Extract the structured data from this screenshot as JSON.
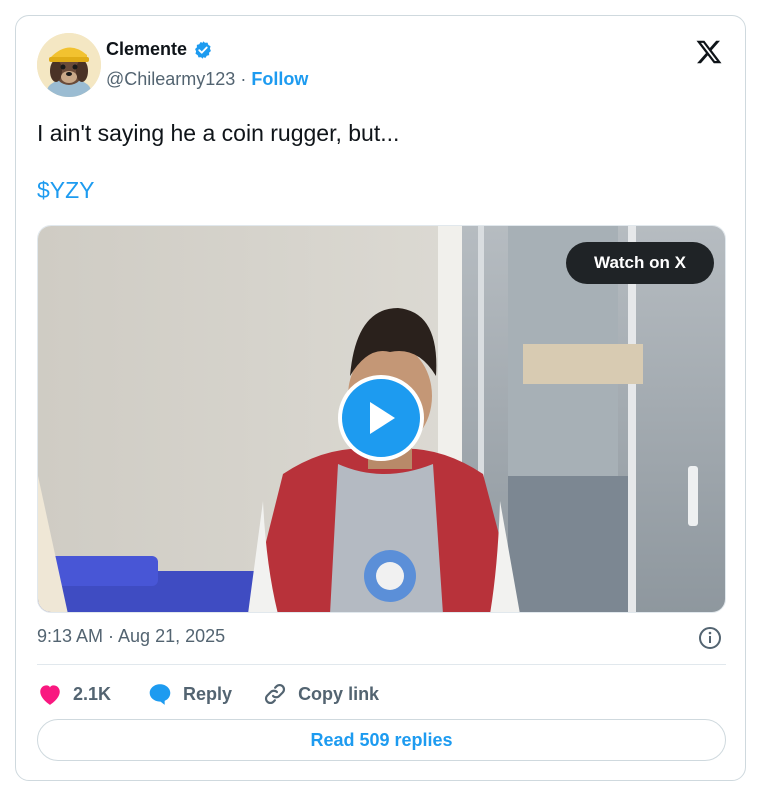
{
  "author": {
    "name": "Clemente",
    "handle": "@Chilearmy123",
    "separator": " · ",
    "follow_label": "Follow"
  },
  "tweet": {
    "text": "I ain't saying he a coin rugger, but...",
    "cashtag": "$YZY"
  },
  "media": {
    "watch_label": "Watch on X"
  },
  "meta": {
    "timestamp": "9:13 AM · Aug 21, 2025"
  },
  "actions": {
    "likes": "2.1K",
    "reply_label": "Reply",
    "copy_link_label": "Copy link"
  },
  "read_replies_label": "Read 509 replies",
  "icons": {
    "verified": "verified-badge-icon",
    "x_logo": "x-logo-icon",
    "play": "play-icon",
    "info": "info-icon",
    "heart": "heart-icon",
    "reply": "reply-bubble-icon",
    "link": "link-icon"
  },
  "colors": {
    "accent": "#1d9bf0",
    "heart": "#f91880",
    "muted": "#536471",
    "text": "#0f1419",
    "border": "#cfd9de"
  }
}
